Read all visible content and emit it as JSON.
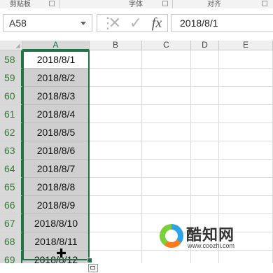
{
  "ribbon": {
    "groups": [
      "剪贴板",
      "字体",
      "对齐"
    ]
  },
  "namebox": {
    "value": "A58"
  },
  "formula": {
    "cancel_icon": "✕",
    "enter_icon": "✓",
    "fx_label": "fx",
    "value": "2018/8/1"
  },
  "columns": [
    "A",
    "B",
    "C",
    "D",
    "E"
  ],
  "rows": [
    {
      "num": "58",
      "value": "2018/8/1"
    },
    {
      "num": "59",
      "value": "2018/8/2"
    },
    {
      "num": "60",
      "value": "2018/8/3"
    },
    {
      "num": "61",
      "value": "2018/8/4"
    },
    {
      "num": "62",
      "value": "2018/8/5"
    },
    {
      "num": "63",
      "value": "2018/8/6"
    },
    {
      "num": "64",
      "value": "2018/8/7"
    },
    {
      "num": "65",
      "value": "2018/8/8"
    },
    {
      "num": "66",
      "value": "2018/8/9"
    },
    {
      "num": "67",
      "value": "2018/8/10"
    },
    {
      "num": "68",
      "value": "2018/8/11"
    },
    {
      "num": "69",
      "value": "2018/8/12"
    }
  ],
  "watermark": {
    "title": "酷知网",
    "url": "www.coozhi.com"
  },
  "colors": {
    "selection": "#217346",
    "row_header_text": "#2e7d32",
    "selected_fill": "#cfcfcf"
  }
}
